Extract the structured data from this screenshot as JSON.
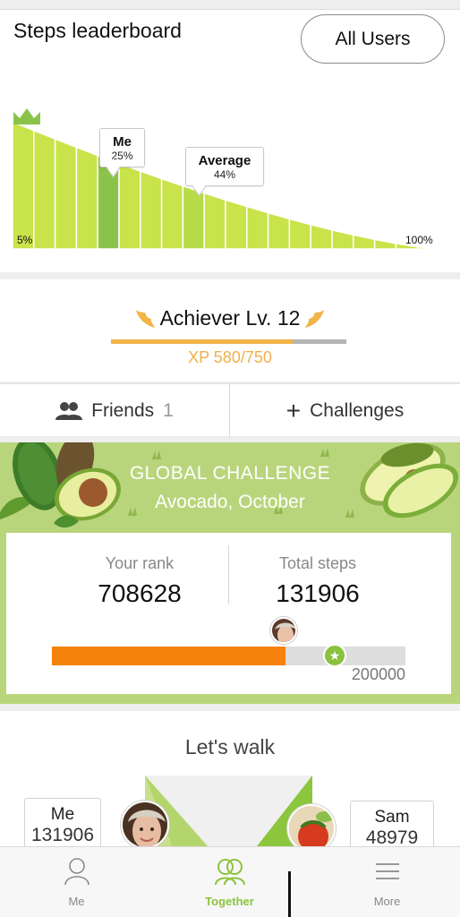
{
  "leaderboard": {
    "title": "Steps leaderboard",
    "all_users_label": "All Users",
    "me_label": "Me",
    "me_value": "25%",
    "average_label": "Average",
    "average_value": "44%",
    "start_label": "5%",
    "end_label": "100%",
    "icons": {
      "crown": "crown-icon"
    },
    "colors": {
      "bar": "#c9e34a",
      "highlight": "#8bc34a",
      "avg_highlight": "#b7dc47"
    }
  },
  "achiever": {
    "title": "Achiever Lv. 12",
    "xp_text": "XP 580/750",
    "xp_progress": 0.773,
    "colors": {
      "accent": "#f2b447",
      "track": "#b5b5b5"
    }
  },
  "tabs": {
    "friends_label": "Friends",
    "friends_count": "1",
    "challenges_label": "Challenges"
  },
  "challenge": {
    "title": "GLOBAL CHALLENGE",
    "subtitle": "Avocado, October",
    "rank_label": "Your rank",
    "rank_value": "708628",
    "steps_label": "Total steps",
    "steps_value": "131906",
    "goal_value": "200000",
    "progress": 0.66,
    "colors": {
      "fill": "#f5820d",
      "track": "#dddddd",
      "banner": "#b9d57c"
    }
  },
  "walk": {
    "title": "Let's walk",
    "me_name": "Me",
    "me_steps": "131906",
    "other_name": "Sam",
    "other_steps": "48979"
  },
  "nav": {
    "items": [
      {
        "label": "Me",
        "icon": "person-icon"
      },
      {
        "label": "Together",
        "icon": "together-icon"
      },
      {
        "label": "More",
        "icon": "menu-icon"
      }
    ],
    "active_color": "#8cc43d"
  }
}
